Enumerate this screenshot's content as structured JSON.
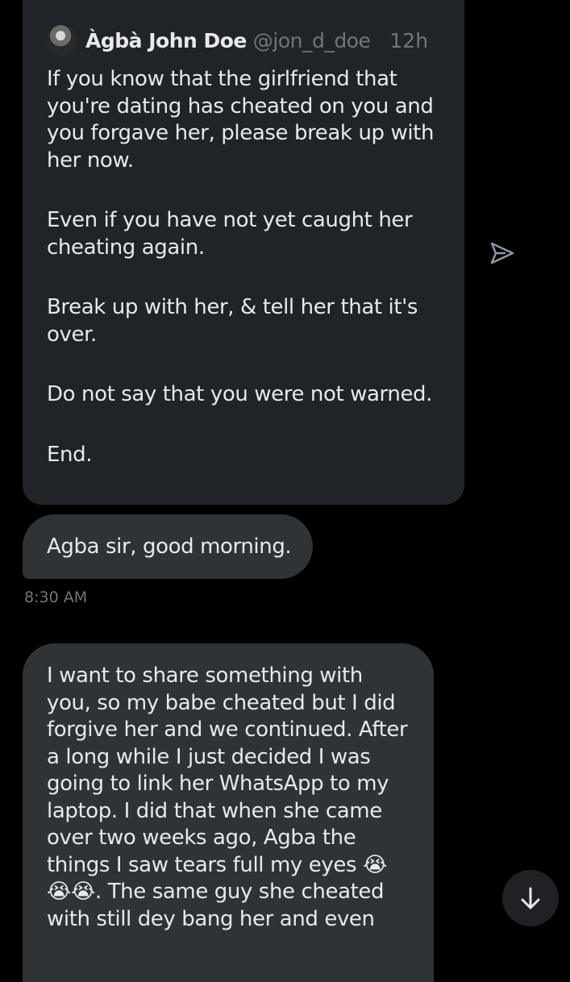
{
  "quoted_post": {
    "author_name": "Àgbà John Doe",
    "author_handle": "@jon_d_doe",
    "time": "12h",
    "paragraphs": [
      "If you know that the girlfriend that you're dating has cheated on you and you forgave her, please break up with her now.",
      "Even if you have not yet caught her cheating again.",
      "Break up with her, & tell her that it's over.",
      "Do not say that you were not warned.",
      "End."
    ]
  },
  "messages": [
    {
      "text": "Agba sir, good morning.",
      "timestamp": "8:30 AM"
    },
    {
      "text": "I want to share something with you, so my babe cheated but I did forgive her and we continued. After a long while I just decided I was going to link her WhatsApp to my laptop. I did that when she came over two weeks ago, Agba the things I saw tears full my eyes 😭😭😭. The same guy she cheated with still dey bang her and even"
    }
  ],
  "icons": {
    "share": "send-icon",
    "scroll": "arrow-down-icon"
  },
  "colors": {
    "background": "#000000",
    "quote_card": "#202327",
    "bubble": "#2f3336",
    "text": "#e7e9ea",
    "muted": "#71767b"
  }
}
